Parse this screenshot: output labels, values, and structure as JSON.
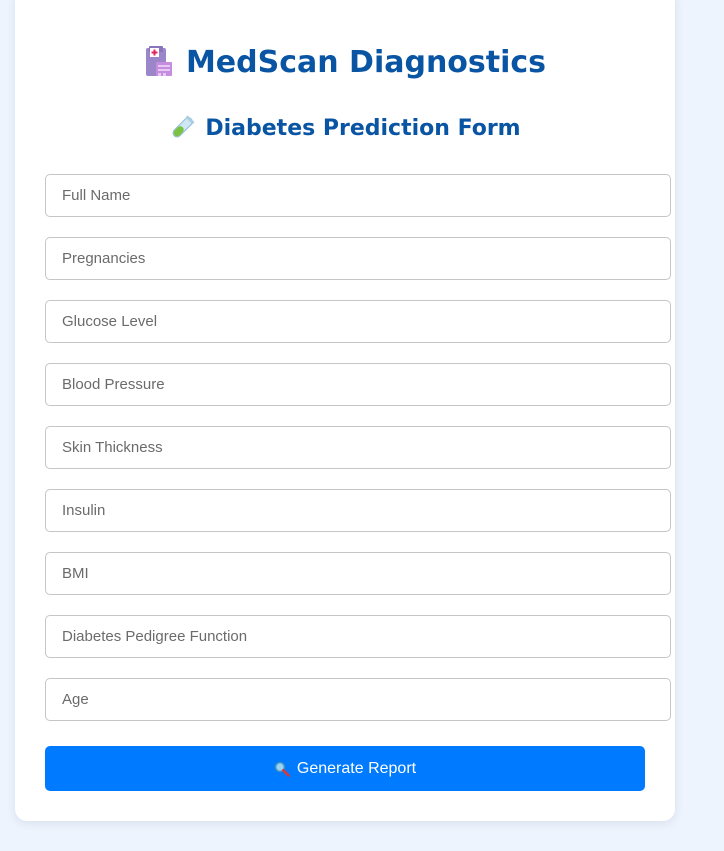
{
  "header": {
    "title": "MedScan Diagnostics",
    "title_icon": "hospital-icon",
    "subtitle": "Diabetes Prediction Form",
    "subtitle_icon": "test-tube-icon"
  },
  "form": {
    "fields": [
      {
        "name": "full-name-field",
        "placeholder": "Full Name",
        "value": ""
      },
      {
        "name": "pregnancies-field",
        "placeholder": "Pregnancies",
        "value": ""
      },
      {
        "name": "glucose-field",
        "placeholder": "Glucose Level",
        "value": ""
      },
      {
        "name": "blood-pressure-field",
        "placeholder": "Blood Pressure",
        "value": ""
      },
      {
        "name": "skin-thickness-field",
        "placeholder": "Skin Thickness",
        "value": ""
      },
      {
        "name": "insulin-field",
        "placeholder": "Insulin",
        "value": ""
      },
      {
        "name": "bmi-field",
        "placeholder": "BMI",
        "value": ""
      },
      {
        "name": "pedigree-field",
        "placeholder": "Diabetes Pedigree Function",
        "value": ""
      },
      {
        "name": "age-field",
        "placeholder": "Age",
        "value": ""
      }
    ],
    "submit_label": "Generate Report",
    "submit_icon": "magnifier-icon"
  },
  "colors": {
    "page_background": "#eef4fd",
    "heading": "#0a55a3",
    "button": "#007bff"
  }
}
